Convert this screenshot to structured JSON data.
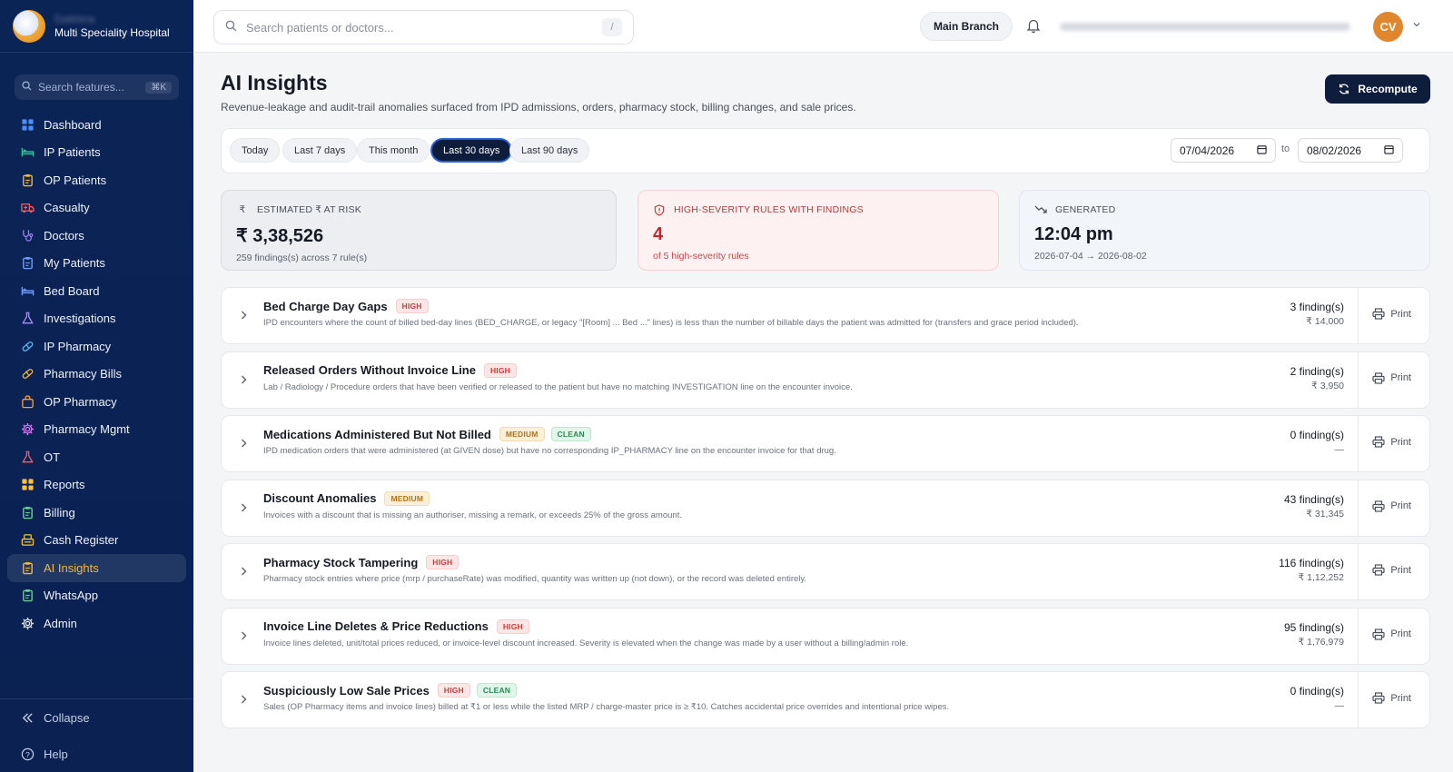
{
  "brand": {
    "name": "Dakhina",
    "subtitle": "Multi Speciality Hospital"
  },
  "sidebar": {
    "search_placeholder": "Search features...",
    "search_shortcut": "⌘K",
    "items": [
      {
        "label": "Dashboard",
        "icon": "grid-icon",
        "color": "#4a8ff7"
      },
      {
        "label": "IP Patients",
        "icon": "bed-icon",
        "color": "#2fc49a"
      },
      {
        "label": "OP Patients",
        "icon": "clipboard-icon",
        "color": "#f6b731"
      },
      {
        "label": "Casualty",
        "icon": "ambulance-icon",
        "color": "#f06060"
      },
      {
        "label": "Doctors",
        "icon": "stethoscope-icon",
        "color": "#9d7cf5"
      },
      {
        "label": "My Patients",
        "icon": "clipboard-icon",
        "color": "#6f9bf7"
      },
      {
        "label": "Bed Board",
        "icon": "bed-icon",
        "color": "#6f9bf7"
      },
      {
        "label": "Investigations",
        "icon": "flask-icon",
        "color": "#a98cf7"
      },
      {
        "label": "IP Pharmacy",
        "icon": "pill-icon",
        "color": "#5fb7f5"
      },
      {
        "label": "Pharmacy Bills",
        "icon": "pill-icon",
        "color": "#f6b731"
      },
      {
        "label": "OP Pharmacy",
        "icon": "bag-icon",
        "color": "#f6a23b"
      },
      {
        "label": "Pharmacy Mgmt",
        "icon": "gear-icon",
        "color": "#d27cf7"
      },
      {
        "label": "OT",
        "icon": "flask-icon",
        "color": "#f06060"
      },
      {
        "label": "Reports",
        "icon": "grid-icon",
        "color": "#f6c43b"
      },
      {
        "label": "Billing",
        "icon": "clipboard-icon",
        "color": "#66d18b"
      },
      {
        "label": "Cash Register",
        "icon": "register-icon",
        "color": "#f6c43b"
      },
      {
        "label": "AI Insights",
        "icon": "clipboard-icon",
        "color": "#f6b731"
      },
      {
        "label": "WhatsApp",
        "icon": "clipboard-icon",
        "color": "#66d18b"
      },
      {
        "label": "Admin",
        "icon": "gear-icon",
        "color": "#e6ebf5"
      }
    ],
    "active_index": 16,
    "collapse_label": "Collapse",
    "help_label": "Help"
  },
  "topbar": {
    "search_placeholder": "Search patients or doctors...",
    "search_shortcut": "/",
    "branch_label": "Main Branch",
    "avatar_initials": "CV"
  },
  "page": {
    "title": "AI Insights",
    "subtitle": "Revenue-leakage and audit-trail anomalies surfaced from IPD admissions, orders, pharmacy stock, billing changes, and sale prices.",
    "recompute_label": "Recompute"
  },
  "filters": {
    "chips": [
      "Today",
      "Last 7 days",
      "This month",
      "Last 30 days",
      "Last 90 days"
    ],
    "active_chip": "Last 30 days",
    "date_from": "07/04/2026",
    "date_to": "08/02/2026",
    "to_label": "to"
  },
  "stats": {
    "at_risk": {
      "label": "ESTIMATED ₹ AT RISK",
      "value": "₹ 3,38,526",
      "foot": "259 findings(s) across 7 rule(s)"
    },
    "high_severity": {
      "label": "HIGH-SEVERITY RULES WITH FINDINGS",
      "value": "4",
      "foot": "of 5 high-severity rules"
    },
    "generated": {
      "label": "GENERATED",
      "value": "12:04 pm",
      "foot": "2026-07-04 → 2026-08-02"
    }
  },
  "rules": [
    {
      "title": "Bed Charge Day Gaps",
      "badges": [
        "HIGH"
      ],
      "desc": "IPD encounters where the count of billed bed-day lines (BED_CHARGE, or legacy \"[Room] ... Bed ...\" lines) is less than the number of billable days the patient was admitted for (transfers and grace period included).",
      "count": "3 finding(s)",
      "amount": "₹ 14,000"
    },
    {
      "title": "Released Orders Without Invoice Line",
      "badges": [
        "HIGH"
      ],
      "desc": "Lab / Radiology / Procedure orders that have been verified or released to the patient but have no matching INVESTIGATION line on the encounter invoice.",
      "count": "2 finding(s)",
      "amount": "₹ 3,950"
    },
    {
      "title": "Medications Administered But Not Billed",
      "badges": [
        "MEDIUM",
        "CLEAN"
      ],
      "desc": "IPD medication orders that were administered (at GIVEN dose) but have no corresponding IP_PHARMACY line on the encounter invoice for that drug.",
      "count": "0 finding(s)",
      "amount": "—"
    },
    {
      "title": "Discount Anomalies",
      "badges": [
        "MEDIUM"
      ],
      "desc": "Invoices with a discount that is missing an authoriser, missing a remark, or exceeds 25% of the gross amount.",
      "count": "43 finding(s)",
      "amount": "₹ 31,345"
    },
    {
      "title": "Pharmacy Stock Tampering",
      "badges": [
        "HIGH"
      ],
      "desc": "Pharmacy stock entries where price (mrp / purchaseRate) was modified, quantity was written up (not down), or the record was deleted entirely.",
      "count": "116 finding(s)",
      "amount": "₹ 1,12,252"
    },
    {
      "title": "Invoice Line Deletes & Price Reductions",
      "badges": [
        "HIGH"
      ],
      "desc": "Invoice lines deleted, unit/total prices reduced, or invoice-level discount increased. Severity is elevated when the change was made by a user without a billing/admin role.",
      "count": "95 finding(s)",
      "amount": "₹ 1,76,979"
    },
    {
      "title": "Suspiciously Low Sale Prices",
      "badges": [
        "HIGH",
        "CLEAN"
      ],
      "desc": "Sales (OP Pharmacy items and invoice lines) billed at ₹1 or less while the listed MRP / charge-master price is ≥ ₹10. Catches accidental price overrides and intentional price wipes.",
      "count": "0 finding(s)",
      "amount": "—"
    }
  ],
  "print_label": "Print"
}
